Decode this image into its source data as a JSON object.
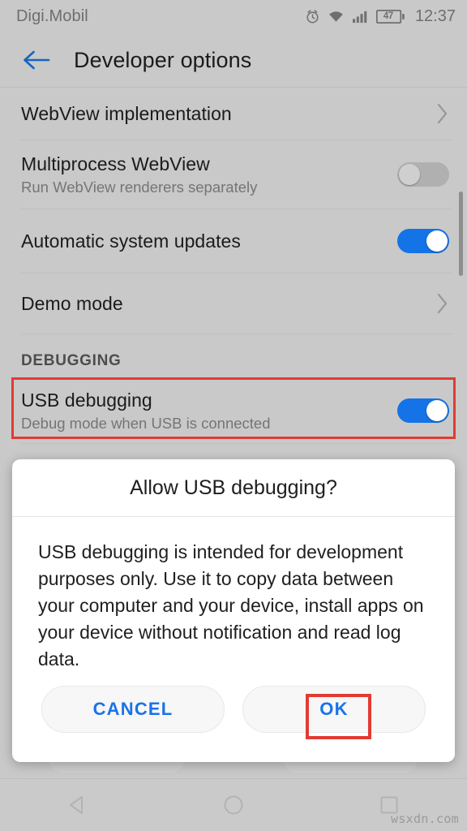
{
  "status_bar": {
    "carrier": "Digi.Mobil",
    "battery_percent": "47",
    "clock": "12:37",
    "icons": [
      "alarm-icon",
      "wifi-icon",
      "signal-icon",
      "battery-icon"
    ]
  },
  "app_bar": {
    "back_label": "back-arrow-icon",
    "title": "Developer options"
  },
  "settings": {
    "rows": [
      {
        "title": "WebView implementation",
        "subtitle": "",
        "control": "chevron"
      },
      {
        "title": "Multiprocess WebView",
        "subtitle": "Run WebView renderers separately",
        "control": "toggle-off"
      },
      {
        "title": "Automatic system updates",
        "subtitle": "",
        "control": "toggle-on"
      },
      {
        "title": "Demo mode",
        "subtitle": "",
        "control": "chevron"
      }
    ],
    "section_header": "DEBUGGING",
    "debug_row": {
      "title": "USB debugging",
      "subtitle": "Debug mode when USB is connected",
      "control": "toggle-on"
    }
  },
  "dialog": {
    "title": "Allow USB debugging?",
    "body": "USB debugging is intended for development purposes only. Use it to copy data between your computer and your device, install apps on your device without notification and read log data.",
    "cancel_label": "CANCEL",
    "ok_label": "OK"
  },
  "nav_bar": {
    "back": "nav-back-icon",
    "home": "nav-home-icon",
    "recents": "nav-recents-icon"
  },
  "watermark": "wsxdn.com",
  "colors": {
    "accent_blue": "#1473e6",
    "link_blue": "#1a73e8",
    "annotation_red": "#e23b32",
    "screen_bg": "#c9c9c9",
    "dialog_bg": "#ffffff"
  }
}
